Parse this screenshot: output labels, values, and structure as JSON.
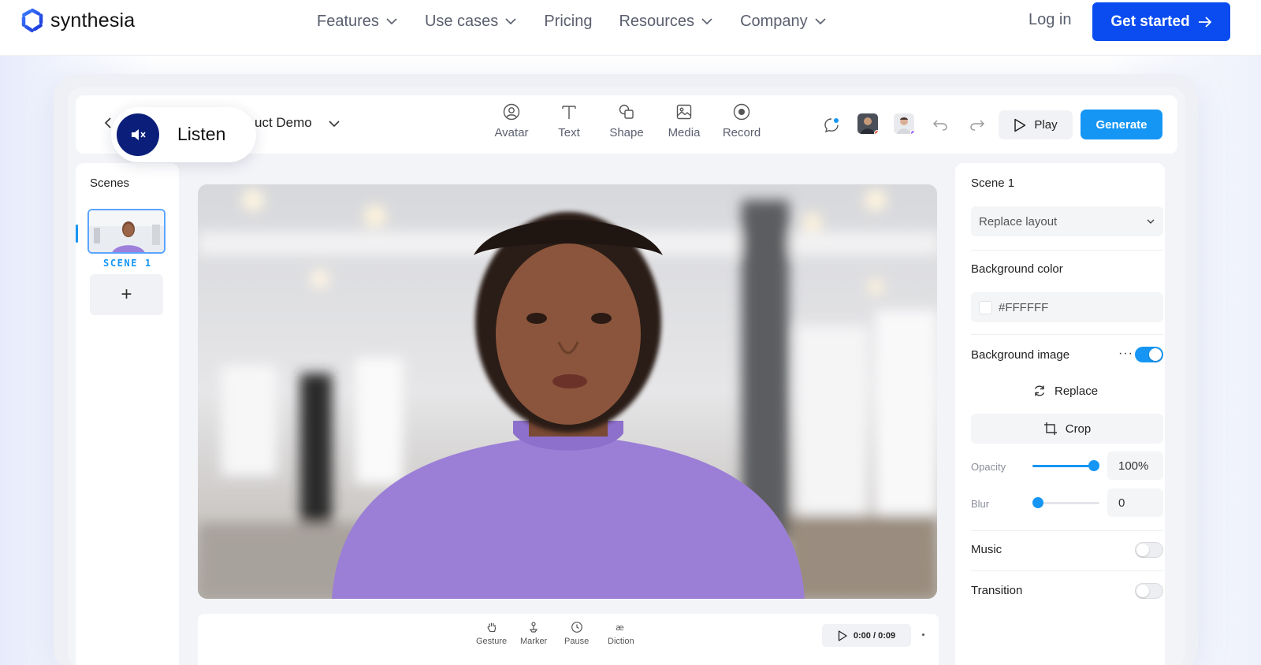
{
  "brand": {
    "name": "synthesia",
    "accent": "#0a4cf0",
    "app_accent": "#1696f4"
  },
  "nav": {
    "items": [
      {
        "label": "Features",
        "has_dropdown": true
      },
      {
        "label": "Use cases",
        "has_dropdown": true
      },
      {
        "label": "Pricing",
        "has_dropdown": false
      },
      {
        "label": "Resources",
        "has_dropdown": true
      },
      {
        "label": "Company",
        "has_dropdown": true
      }
    ],
    "login": "Log in",
    "cta": "Get started"
  },
  "listen": {
    "label": "Listen",
    "icon": "speaker-muted-icon"
  },
  "editor": {
    "project_title": "uct Demo",
    "tools": [
      {
        "label": "Avatar",
        "icon": "avatar-icon"
      },
      {
        "label": "Text",
        "icon": "text-icon"
      },
      {
        "label": "Shape",
        "icon": "shape-icon"
      },
      {
        "label": "Media",
        "icon": "media-icon"
      },
      {
        "label": "Record",
        "icon": "record-icon"
      }
    ],
    "play_label": "Play",
    "generate_label": "Generate",
    "scenes": {
      "title": "Scenes",
      "items": [
        {
          "label": "SCENE 1"
        }
      ],
      "add": "+"
    },
    "bottom_tools": [
      {
        "label": "Gesture",
        "icon": "hand-icon"
      },
      {
        "label": "Marker",
        "icon": "marker-icon"
      },
      {
        "label": "Pause",
        "icon": "clock-icon"
      },
      {
        "label": "Diction",
        "icon": "diction-icon"
      }
    ],
    "timecode": "0:00 / 0:09",
    "right_panel": {
      "scene_title": "Scene 1",
      "layout_select": "Replace layout",
      "bg_color_label": "Background color",
      "bg_color_value": "#FFFFFF",
      "bg_image_label": "Background image",
      "bg_image_enabled": true,
      "replace_label": "Replace",
      "crop_label": "Crop",
      "opacity_label": "Opacity",
      "opacity_value": "100%",
      "opacity_level": 1.0,
      "blur_label": "Blur",
      "blur_value": "0",
      "blur_level": 0.0,
      "music_label": "Music",
      "music_enabled": false,
      "transition_label": "Transition",
      "transition_enabled": false
    }
  }
}
